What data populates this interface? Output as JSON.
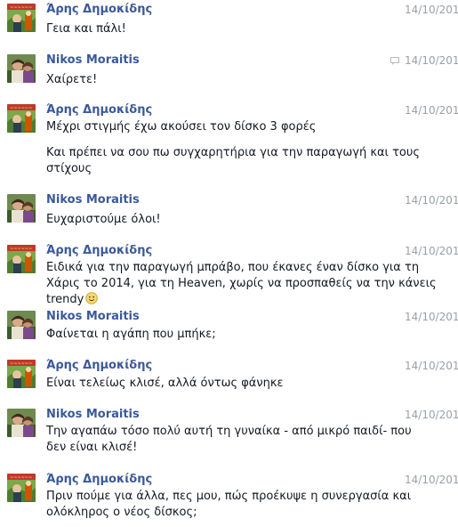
{
  "messages": [
    {
      "sender": "Άρης Δημοκίδης",
      "avatar": "aris",
      "time": "14/10/2014",
      "reply_icon": false,
      "lines": [
        "Γεια και πάλι!"
      ]
    },
    {
      "sender": "Nikos Moraitis",
      "avatar": "nikos",
      "time": "14/10/2014",
      "reply_icon": true,
      "lines": [
        "Χαίρετε!"
      ]
    },
    {
      "sender": "Άρης Δημοκίδης",
      "avatar": "aris",
      "time": "14/10/2014",
      "reply_icon": false,
      "lines": [
        "Μέχρι στιγμής έχω ακούσει τον δίσκο 3 φορές",
        "Και πρέπει να σου πω συγχαρητήρια για την παραγωγή και τους στίχους"
      ]
    },
    {
      "sender": "Nikos Moraitis",
      "avatar": "nikos",
      "time": "14/10/2014",
      "reply_icon": false,
      "lines": [
        "Ευχαριστούμε όλοι!"
      ]
    },
    {
      "sender": "Άρης Δημοκίδης",
      "avatar": "aris",
      "time": "14/10/2014",
      "reply_icon": false,
      "lines": [
        "Ειδικά για την παραγωγή μπράβο, που έκανες έναν δίσκο για τη Χάρις το 2014, για τη Heaven, χωρίς να προσπαθείς να την κάνεις trendy"
      ]
    },
    {
      "sender": "Nikos Moraitis",
      "avatar": "nikos",
      "time": "14/10/2014",
      "reply_icon": false,
      "lines": [
        "Φαίνεται η αγάπη που μπήκε;"
      ]
    },
    {
      "sender": "Άρης Δημοκίδης",
      "avatar": "aris",
      "time": "14/10/2014",
      "reply_icon": false,
      "lines": [
        "Είναι τελείως κλισέ, αλλά όντως φάνηκε"
      ]
    },
    {
      "sender": "Nikos Moraitis",
      "avatar": "nikos",
      "time": "14/10/2014",
      "reply_icon": false,
      "lines": [
        "Την αγαπάω τόσο πολύ αυτή τη γυναίκα - από μικρό παιδί- που δεν είναι κλισέ!"
      ]
    },
    {
      "sender": "Άρης Δημοκίδης",
      "avatar": "aris",
      "time": "14/10/2014",
      "reply_icon": false,
      "lines": [
        "Πριν πούμε για άλλα, πες μου, πώς προέκυψε η συνεργασία και ολόκληρος ο νέος δίσκος;"
      ]
    }
  ],
  "colors": {
    "name": "#3b5998",
    "text": "#141823",
    "time": "#9aa0a9"
  },
  "icons": {
    "reply": "reply-icon",
    "smiley": "smiley-emoticon-icon"
  }
}
